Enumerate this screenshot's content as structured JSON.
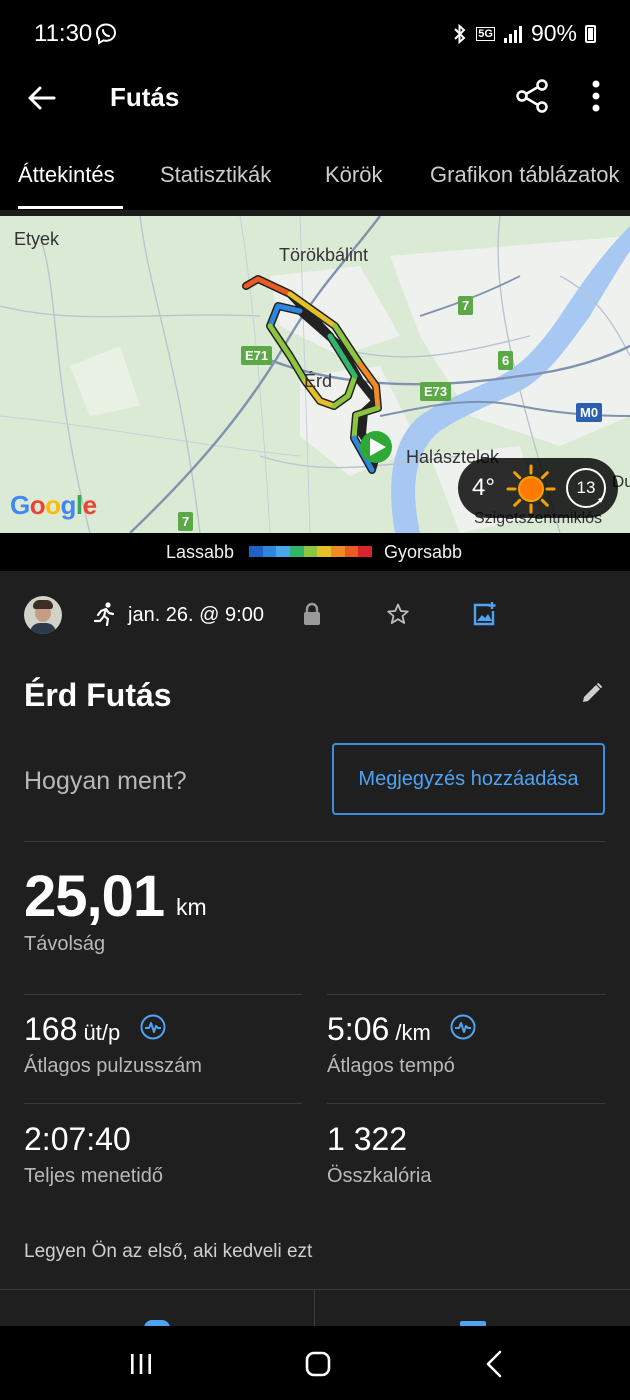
{
  "status_bar": {
    "time": "11:30",
    "network": "5G",
    "battery": "90%"
  },
  "app_bar": {
    "title": "Futás",
    "icons": [
      "back-arrow-icon",
      "share-icon",
      "more-vert-icon"
    ]
  },
  "tabs": [
    {
      "label": "Áttekintés",
      "active": true
    },
    {
      "label": "Statisztikák",
      "active": false
    },
    {
      "label": "Körök",
      "active": false
    },
    {
      "label": "Grafikon táblázatok",
      "active": false
    }
  ],
  "map": {
    "places": [
      "Etyek",
      "Törökbálint",
      "Érd",
      "Halásztelek",
      "Szigetszentmiklós",
      "Du"
    ],
    "road_shields": [
      "E71",
      "7",
      "6",
      "E73",
      "M0",
      "7"
    ],
    "attribution": "Google",
    "weather": {
      "temperature": "4°",
      "wind": "13",
      "icon": "sun-icon"
    }
  },
  "legend": {
    "slow_label": "Lassabb",
    "fast_label": "Gyorsabb",
    "colors": [
      "#1d62c4",
      "#2f86dd",
      "#4aa6ea",
      "#2fb66a",
      "#8cc63f",
      "#e3c028",
      "#f08a24",
      "#ea5a22",
      "#d9242b"
    ]
  },
  "activity": {
    "date": "jan. 26. @ 9:00",
    "title": "Érd Futás",
    "how_prompt": "Hogyan ment?",
    "add_note_label": "Megjegyzés hozzáadása",
    "distance": {
      "value": "25,01",
      "unit": "km",
      "label": "Távolság"
    },
    "avg_hr": {
      "value": "168",
      "unit": " üt/p",
      "label": "Átlagos pulzusszám"
    },
    "avg_pace": {
      "value": "5:06",
      "unit": " /km",
      "label": "Átlagos tempó"
    },
    "total_time": {
      "value": "2:07:40",
      "label": "Teljes menetidő"
    },
    "calories": {
      "value": "1 322",
      "label": "Összkalória"
    },
    "like_prompt": "Legyen Ön az első, aki kedveli ezt"
  },
  "accent_color": "#4ea3f2"
}
